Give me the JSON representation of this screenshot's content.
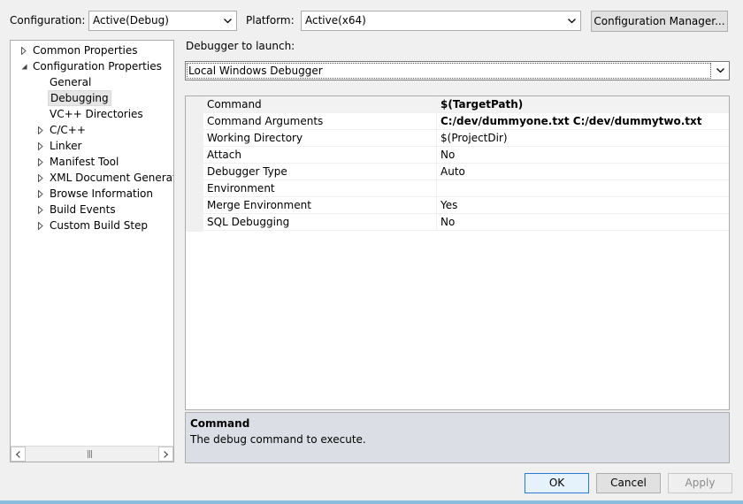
{
  "header": {
    "configuration_label": "Configuration:",
    "configuration_value": "Active(Debug)",
    "platform_label": "Platform:",
    "platform_value": "Active(x64)",
    "config_manager_button": "Configuration Manager..."
  },
  "tree": {
    "items": [
      {
        "label": "Common Properties",
        "expander": "collapsed"
      },
      {
        "label": "Configuration Properties",
        "expander": "expanded"
      },
      {
        "label": "General",
        "expander": "none"
      },
      {
        "label": "Debugging",
        "expander": "none",
        "selected": true
      },
      {
        "label": "VC++ Directories",
        "expander": "none"
      },
      {
        "label": "C/C++",
        "expander": "collapsed"
      },
      {
        "label": "Linker",
        "expander": "collapsed"
      },
      {
        "label": "Manifest Tool",
        "expander": "collapsed"
      },
      {
        "label": "XML Document Generator",
        "expander": "collapsed"
      },
      {
        "label": "Browse Information",
        "expander": "collapsed"
      },
      {
        "label": "Build Events",
        "expander": "collapsed"
      },
      {
        "label": "Custom Build Step",
        "expander": "collapsed"
      }
    ]
  },
  "debugger": {
    "label": "Debugger to launch:",
    "value": "Local Windows Debugger"
  },
  "properties": [
    {
      "name": "Command",
      "value": "$(TargetPath)",
      "bold": true
    },
    {
      "name": "Command Arguments",
      "value": "C:/dev/dummyone.txt C:/dev/dummytwo.txt",
      "bold": true
    },
    {
      "name": "Working Directory",
      "value": "$(ProjectDir)",
      "bold": false
    },
    {
      "name": "Attach",
      "value": "No",
      "bold": false
    },
    {
      "name": "Debugger Type",
      "value": "Auto",
      "bold": false
    },
    {
      "name": "Environment",
      "value": "",
      "bold": false
    },
    {
      "name": "Merge Environment",
      "value": "Yes",
      "bold": false
    },
    {
      "name": "SQL Debugging",
      "value": "No",
      "bold": false
    }
  ],
  "description": {
    "title": "Command",
    "text": "The debug command to execute."
  },
  "footer": {
    "ok": "OK",
    "cancel": "Cancel",
    "apply": "Apply"
  }
}
